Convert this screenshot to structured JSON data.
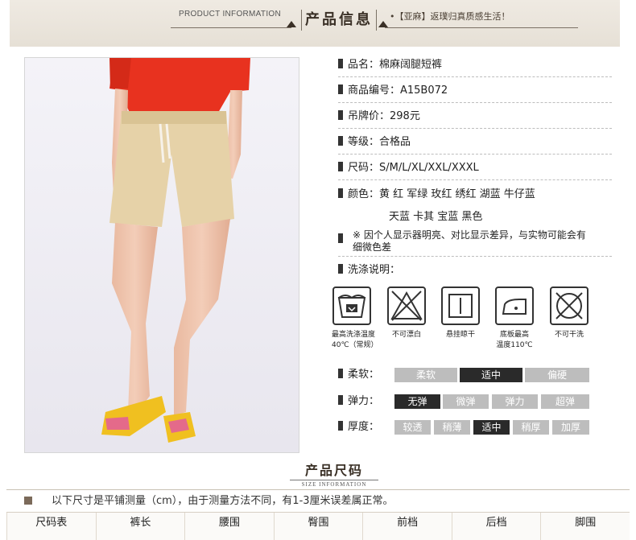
{
  "header": {
    "product_information": "PRODUCT INFORMATION",
    "badge": "产品信息",
    "slogan": "•【亚麻】返璞归真质感生活！"
  },
  "info": {
    "name": "品名：棉麻阔腿短裤",
    "code": "商品编号：A15B072",
    "price": "吊牌价：298元",
    "grade": "等级：合格品",
    "sizes": "尺码：S/M/L/XL/XXL/XXXL",
    "colors_line1": "颜色：黄 红 军绿 玫红 绣红 湖蓝 牛仔蓝",
    "colors_line2": "天蓝 卡其 宝蓝 黑色",
    "note": "※ 因个人显示器明亮、对比显示差异，与实物可能会有细微色差",
    "wash_title": "洗涤说明："
  },
  "wash": [
    {
      "icon": "wash-temp-40-icon",
      "caption1": "最高洗涤温度",
      "caption2": "40℃（常规）"
    },
    {
      "icon": "no-bleach-icon",
      "caption1": "不可漂白",
      "caption2": ""
    },
    {
      "icon": "hang-dry-icon",
      "caption1": "悬挂晾干",
      "caption2": ""
    },
    {
      "icon": "iron-110-icon",
      "caption1": "底板最高",
      "caption2": "温度110℃"
    },
    {
      "icon": "no-dry-clean-icon",
      "caption1": "不可干洗",
      "caption2": ""
    }
  ],
  "attributes": [
    {
      "label": "柔软：",
      "options": [
        "柔软",
        "适中",
        "偏硬"
      ],
      "selected": 1
    },
    {
      "label": "弹力：",
      "options": [
        "无弹",
        "微弹",
        "弹力",
        "超弹"
      ],
      "selected": 0
    },
    {
      "label": "厚度：",
      "options": [
        "较透",
        "稍薄",
        "适中",
        "稍厚",
        "加厚"
      ],
      "selected": 2
    }
  ],
  "size_section": {
    "title_cn": "产品尺码",
    "title_en": "SIZE INFORMATION",
    "note": "以下尺寸是平铺测量（cm），由于测量方法不同，有1-3厘米误差属正常。",
    "columns": [
      "尺码表",
      "裤长",
      "腰围",
      "臀围",
      "前档",
      "后档",
      "脚围"
    ]
  },
  "colors": {
    "shirt": "#e8321f",
    "shorts": "#e6d2a8",
    "shoe": "#f0c020",
    "bar_on": "#2a2a2a",
    "bar_off": "#bdbdbd"
  }
}
